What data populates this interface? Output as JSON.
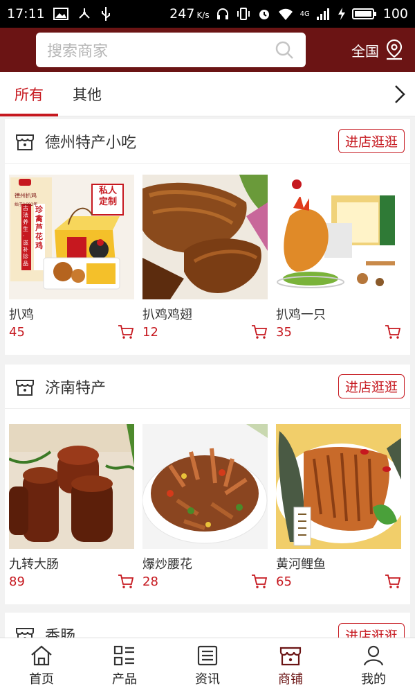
{
  "status_bar": {
    "time": "17:11",
    "speed": "247",
    "speed_unit": "K/s",
    "network": "4G",
    "battery": "100"
  },
  "header": {
    "search_placeholder": "搜索商家",
    "region": "全国"
  },
  "tabs": [
    {
      "label": "所有",
      "active": true
    },
    {
      "label": "其他",
      "active": false
    }
  ],
  "shops": [
    {
      "name": "德州特产小吃",
      "button": "进店逛逛",
      "products": [
        {
          "name": "扒鸡",
          "price": "45"
        },
        {
          "name": "扒鸡鸡翅",
          "price": "12"
        },
        {
          "name": "扒鸡一只",
          "price": "35"
        }
      ]
    },
    {
      "name": "济南特产",
      "button": "进店逛逛",
      "products": [
        {
          "name": "九转大肠",
          "price": "89"
        },
        {
          "name": "爆炒腰花",
          "price": "28"
        },
        {
          "name": "黄河鲤鱼",
          "price": "65"
        }
      ]
    },
    {
      "name": "香肠",
      "button": "进店逛逛"
    }
  ],
  "product_image_text": {
    "box_brand": "德州扒鸡",
    "box_title": "珍禽芦花鸡",
    "box_side": "古法养生·滋补珍品",
    "box_badge": "私人定制",
    "box_badge_year": "始于1692年"
  },
  "tabbar": [
    {
      "label": "首页",
      "icon": "home-icon"
    },
    {
      "label": "产品",
      "icon": "product-grid-icon"
    },
    {
      "label": "资讯",
      "icon": "news-icon"
    },
    {
      "label": "商铺",
      "icon": "shop-icon"
    },
    {
      "label": "我的",
      "icon": "user-icon"
    }
  ],
  "colors": {
    "header": "#6b1414",
    "accent": "#c6181f"
  }
}
